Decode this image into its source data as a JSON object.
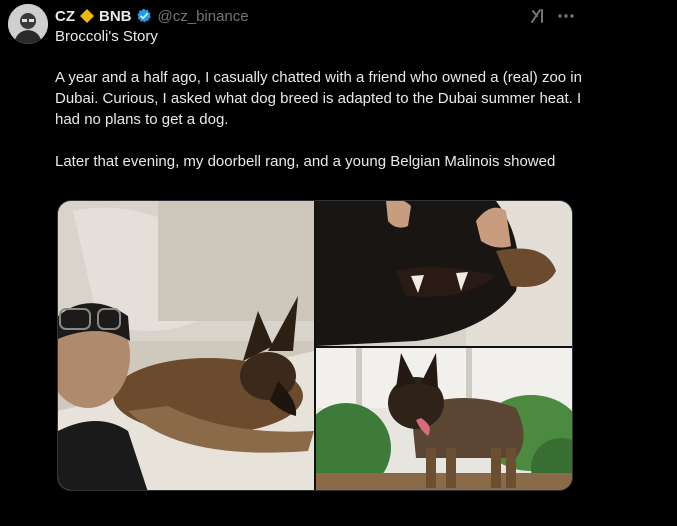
{
  "author": {
    "name": "CZ",
    "affiliation": "BNB",
    "handle": "@cz_binance",
    "verified": true
  },
  "tweet": {
    "title": "Broccoli's Story",
    "paragraphs": [
      "A year and a half ago, I casually chatted with a friend who owned a (real) zoo in Dubai. Curious, I asked what dog breed is adapted to the Dubai summer heat. I had no plans to get a dog.",
      "Later that evening, my doorbell rang, and a young Belgian Malinois showed"
    ]
  },
  "icons": {
    "diamond": "binance-diamond-icon",
    "verified": "verified-check-icon",
    "grok": "grok-icon",
    "more": "more-options-icon"
  },
  "colors": {
    "background": "#000000",
    "text": "#e7e9ea",
    "muted": "#71767b",
    "verified": "#1d9bf0",
    "binance": "#f0b90b"
  }
}
